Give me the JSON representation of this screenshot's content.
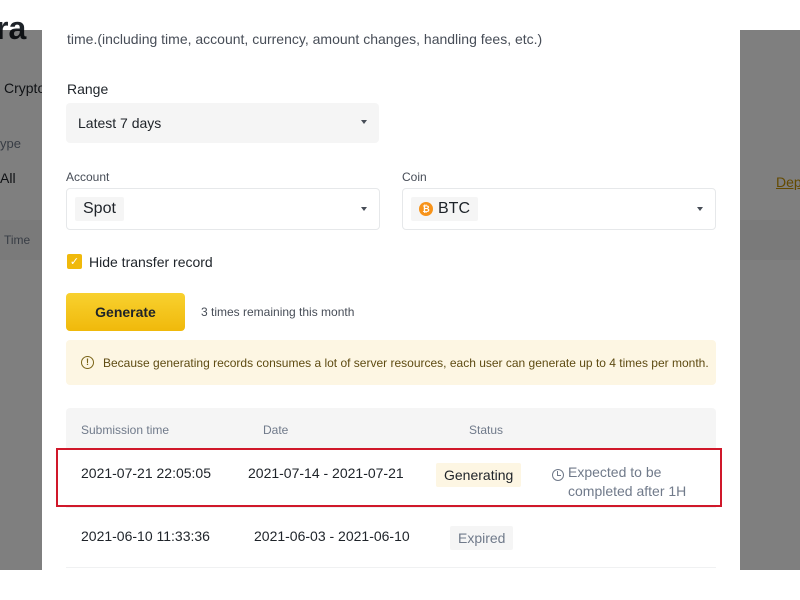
{
  "background": {
    "title_fragment": "ra",
    "tab_fragment": "Crypto",
    "type_label_fragment": "ype",
    "type_value": "All",
    "time_header": "Time",
    "link_fragment": "Dep"
  },
  "modal": {
    "description": "time.(including time, account, currency, amount changes, handling fees, etc.)",
    "range": {
      "label": "Range",
      "value": "Latest 7 days"
    },
    "account": {
      "label": "Account",
      "value": "Spot"
    },
    "coin": {
      "label": "Coin",
      "value": "BTC",
      "icon": "bitcoin-icon"
    },
    "hide_transfer": {
      "label": "Hide transfer record",
      "checked": true
    },
    "generate_button": "Generate",
    "remaining_text": "3 times remaining this month",
    "notice": "Because generating records consumes a lot of server resources, each user can generate up to 4 times per month.",
    "table": {
      "headers": {
        "submission": "Submission time",
        "date": "Date",
        "status": "Status"
      },
      "rows": [
        {
          "submission_time": "2021-07-21 22:05:05",
          "date_range": "2021-07-14 - 2021-07-21",
          "status": "Generating",
          "note_line1": "Expected to be",
          "note_line2": "completed after 1H"
        },
        {
          "submission_time": "2021-06-10 11:33:36",
          "date_range": "2021-06-03 - 2021-06-10",
          "status": "Expired"
        }
      ]
    }
  },
  "colors": {
    "accent": "#f0b90b",
    "highlight": "#d0182a",
    "notice_bg": "#fdf6e3"
  }
}
